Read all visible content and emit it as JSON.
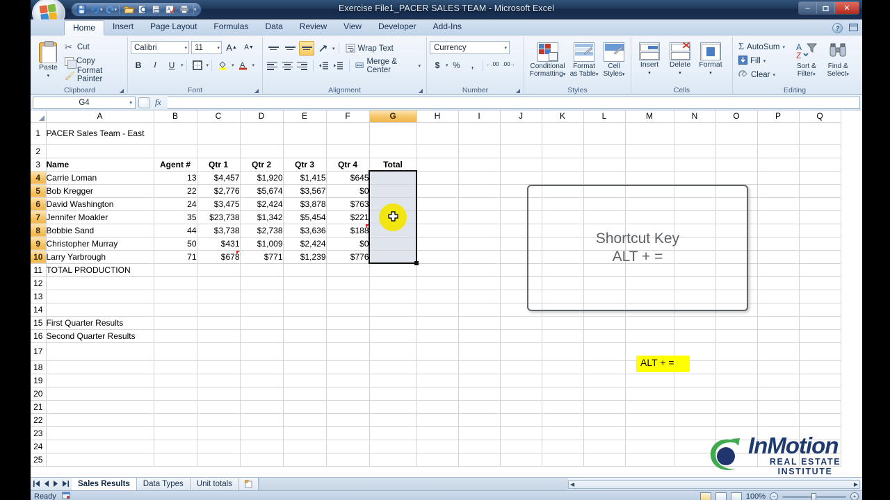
{
  "window": {
    "title": "Exercise File1_PACER SALES TEAM  -  Microsoft Excel",
    "minimize": "–",
    "restore": "❐",
    "close": "✕"
  },
  "quick_access": {
    "items": [
      "save-icon",
      "undo-icon",
      "redo-icon",
      "open-icon",
      "print-preview-icon",
      "quick-print-icon",
      "spelling-icon",
      "print-icon"
    ],
    "customize": "▾"
  },
  "ribbon": {
    "tabs": [
      {
        "label": "Home",
        "active": true
      },
      {
        "label": "Insert",
        "active": false
      },
      {
        "label": "Page Layout",
        "active": false
      },
      {
        "label": "Formulas",
        "active": false
      },
      {
        "label": "Data",
        "active": false
      },
      {
        "label": "Review",
        "active": false
      },
      {
        "label": "View",
        "active": false
      },
      {
        "label": "Developer",
        "active": false
      },
      {
        "label": "Add-Ins",
        "active": false
      }
    ],
    "help_label": "?",
    "groups": {
      "clipboard": {
        "label": "Clipboard",
        "paste": "Paste",
        "paste_arrow": "▾",
        "cut": "Cut",
        "copy": "Copy",
        "format_painter": "Format Painter"
      },
      "font": {
        "label": "Font",
        "font_name": "Calibri",
        "font_size": "11",
        "grow_font": "A",
        "shrink_font": "A",
        "bold": "B",
        "italic": "I",
        "underline": "U",
        "borders": "□",
        "fill_color": "A",
        "font_color": "A",
        "dropdown": "▾"
      },
      "alignment": {
        "label": "Alignment",
        "wrap_text": "Wrap Text",
        "merge_center": "Merge & Center",
        "merge_arrow": "▾",
        "orientation": "↻"
      },
      "number": {
        "label": "Number",
        "format": "Currency",
        "currency": "$",
        "percent": "%",
        "comma": ",",
        "increase_decimal": ".00",
        "decrease_decimal": ".00",
        "dropdown": "▾"
      },
      "styles": {
        "label": "Styles",
        "conditional_formatting": "Conditional\nFormatting",
        "conditional_formatting_l1": "Conditional",
        "conditional_formatting_l2": "Formatting",
        "format_as_table_l1": "Format",
        "format_as_table_l2": "as Table",
        "cell_styles_l1": "Cell",
        "cell_styles_l2": "Styles",
        "arrow": "▾"
      },
      "cells": {
        "label": "Cells",
        "insert": "Insert",
        "delete": "Delete",
        "format": "Format",
        "arrow": "▾"
      },
      "editing": {
        "label": "Editing",
        "autosum": "AutoSum",
        "autosum_sigma": "Σ",
        "fill": "Fill",
        "clear": "Clear",
        "sort_filter_l1": "Sort &",
        "sort_filter_l2": "Filter",
        "find_select_l1": "Find &",
        "find_select_l2": "Select",
        "arrow": "▾"
      }
    }
  },
  "formula_bar": {
    "name_box": "G4",
    "name_box_arrow": "▾",
    "fx_label": "fx",
    "formula_value": ""
  },
  "sheet": {
    "columns": [
      "A",
      "B",
      "C",
      "D",
      "E",
      "F",
      "G",
      "H",
      "I",
      "J",
      "K",
      "L",
      "M",
      "N",
      "O",
      "P",
      "Q"
    ],
    "selected_column": "G",
    "selected_rows": [
      4,
      5,
      6,
      7,
      8,
      9,
      10
    ],
    "selection_range": "G4:G10",
    "rows": [
      {
        "num": "1",
        "cells": {
          "A": "PACER Sales Team - East"
        }
      },
      {
        "num": "2",
        "cells": {}
      },
      {
        "num": "3",
        "cells": {
          "A": "Name",
          "B": "Agent #",
          "C": "Qtr 1",
          "D": "Qtr 2",
          "E": "Qtr 3",
          "F": "Qtr 4",
          "G": "Total"
        },
        "bold": true
      },
      {
        "num": "4",
        "cells": {
          "A": "Carrie Loman",
          "B": "13",
          "C": "$4,457",
          "D": "$1,920",
          "E": "$1,415",
          "F": "$645",
          "G": ""
        }
      },
      {
        "num": "5",
        "cells": {
          "A": "Bob Kregger",
          "B": "22",
          "C": "$2,776",
          "D": "$5,674",
          "E": "$3,567",
          "F": "$0",
          "G": ""
        }
      },
      {
        "num": "6",
        "cells": {
          "A": "David Washington",
          "B": "24",
          "C": "$3,475",
          "D": "$2,424",
          "E": "$3,878",
          "F": "$763",
          "G": ""
        }
      },
      {
        "num": "7",
        "cells": {
          "A": "Jennifer Moakler",
          "B": "35",
          "C": "$23,738",
          "D": "$1,342",
          "E": "$5,454",
          "F": "$221",
          "G": ""
        }
      },
      {
        "num": "8",
        "cells": {
          "A": "Bobbie Sand",
          "B": "44",
          "C": "$3,738",
          "D": "$2,738",
          "E": "$3,636",
          "F": "$188",
          "G": ""
        }
      },
      {
        "num": "9",
        "cells": {
          "A": "Christopher Murray",
          "B": "50",
          "C": "$431",
          "D": "$1,009",
          "E": "$2,424",
          "F": "$0",
          "G": ""
        }
      },
      {
        "num": "10",
        "cells": {
          "A": "Larry Yarbrough",
          "B": "71",
          "C": "$678",
          "D": "$771",
          "E": "$1,239",
          "F": "$776",
          "G": ""
        }
      },
      {
        "num": "11",
        "cells": {
          "A": "TOTAL PRODUCTION"
        }
      },
      {
        "num": "12",
        "cells": {}
      },
      {
        "num": "13",
        "cells": {}
      },
      {
        "num": "14",
        "cells": {}
      },
      {
        "num": "15",
        "cells": {
          "A": "First Quarter Results"
        }
      },
      {
        "num": "16",
        "cells": {
          "A": "Second Quarter Results"
        }
      },
      {
        "num": "17",
        "cells": {}
      },
      {
        "num": "18",
        "cells": {}
      },
      {
        "num": "19",
        "cells": {}
      },
      {
        "num": "20",
        "cells": {}
      },
      {
        "num": "21",
        "cells": {}
      },
      {
        "num": "22",
        "cells": {}
      },
      {
        "num": "23",
        "cells": {}
      },
      {
        "num": "24",
        "cells": {}
      },
      {
        "num": "25",
        "cells": {}
      }
    ],
    "comment_cells": [
      "F8",
      "C10"
    ]
  },
  "annotations": {
    "callout": {
      "line1": "Shortcut Key",
      "line2": "ALT + ="
    },
    "highlight_tag": "ALT + =",
    "logo": {
      "name_part1": "InMotion",
      "tagline": "REAL ESTATE INSTITUTE"
    }
  },
  "sheet_tabs": {
    "nav_first": "⏮",
    "nav_prev": "◀",
    "nav_next": "▶",
    "nav_last": "⏭",
    "tabs": [
      {
        "label": "Sales Results",
        "active": true
      },
      {
        "label": "Data Types",
        "active": false
      },
      {
        "label": "Unit totals",
        "active": false
      }
    ],
    "insert_tab": "insert-worksheet-icon"
  },
  "status_bar": {
    "status": "Ready",
    "zoom": "100%",
    "zoom_out": "−",
    "zoom_in": "+",
    "views": [
      "normal-view",
      "page-layout-view",
      "page-break-view"
    ]
  }
}
